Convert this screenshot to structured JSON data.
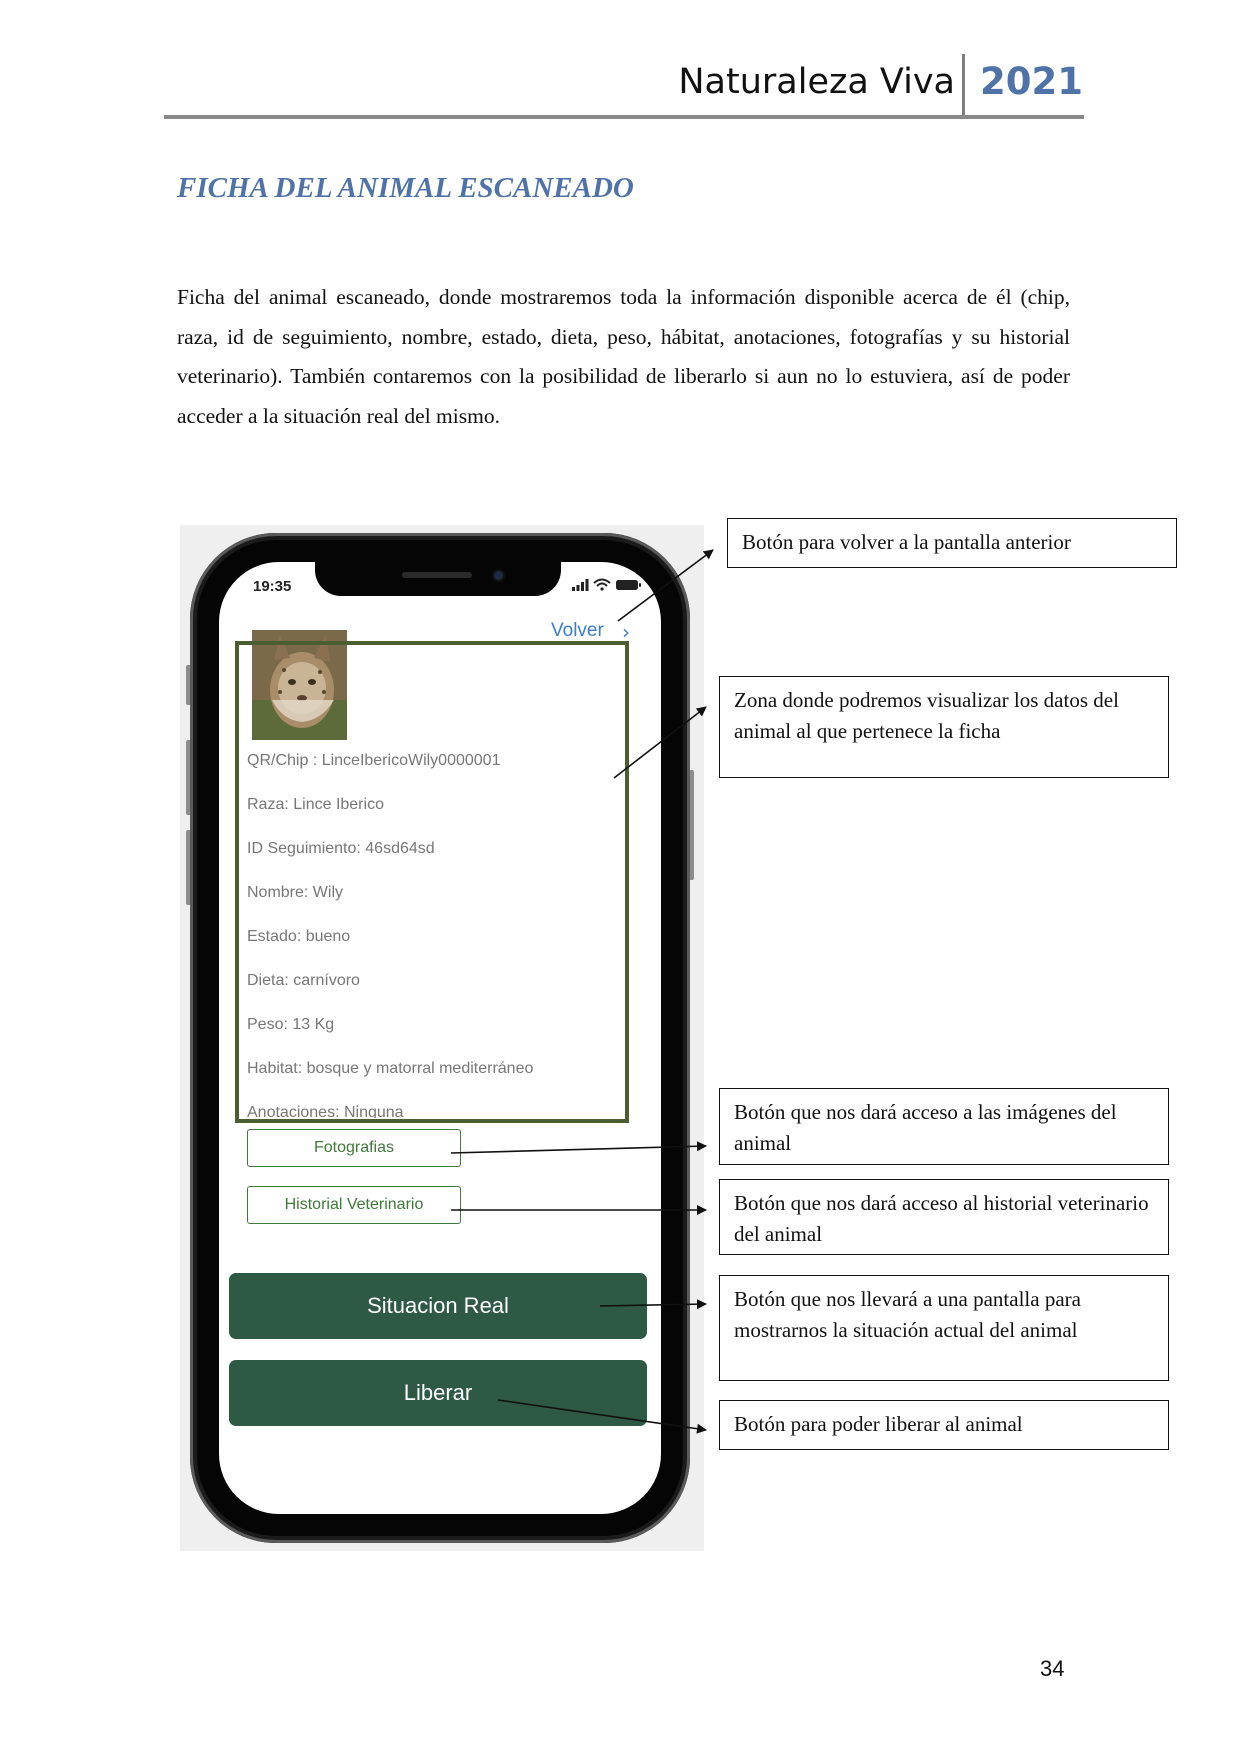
{
  "header": {
    "title": "Naturaleza Viva",
    "year": "2021"
  },
  "section": {
    "heading": "FICHA DEL ANIMAL ESCANEADO",
    "body": "Ficha del animal escaneado, donde mostraremos toda la información disponible acerca de él (chip, raza, id de seguimiento, nombre, estado, dieta, peso, hábitat, anotaciones, fotografías y su historial veterinario). También contaremos con la posibilidad de liberarlo si aun no lo estuviera, así de poder acceder a la situación real del mismo."
  },
  "phone": {
    "status_time": "19:35",
    "back_label": "Volver",
    "animal_photo_icon": "lynx-photo",
    "fields": [
      "QR/Chip : LinceIbericoWily0000001",
      "Raza: Lince Iberico",
      "ID Seguimiento: 46sd64sd",
      "Nombre: Wily",
      "Estado: bueno",
      "Dieta: carnívoro",
      "Peso: 13 Kg",
      "Habitat: bosque y matorral mediterráneo",
      "Anotaciones: Ninguna"
    ],
    "photos_button": "Fotografias",
    "vet_history_button": "Historial Veterinario",
    "real_situation_button": "Situacion Real",
    "release_button": "Liberar"
  },
  "callouts": {
    "back": "Botón para volver a la pantalla anterior",
    "data_zone": "Zona donde podremos visualizar los datos del animal al que pertenece la ficha",
    "photos": "Botón que nos dará acceso a las imágenes del animal",
    "vet_history": "Botón que nos dará acceso al historial veterinario del animal",
    "real_situation": "Botón que nos llevará a una pantalla para mostrarnos la situación actual del animal",
    "release": "Botón para poder liberar al animal"
  },
  "page_number": "34",
  "colors": {
    "accent_blue": "#4f73a8",
    "app_green": "#2e5a45",
    "zone_border": "#4a5e2f",
    "link_blue": "#3d7ec5"
  }
}
